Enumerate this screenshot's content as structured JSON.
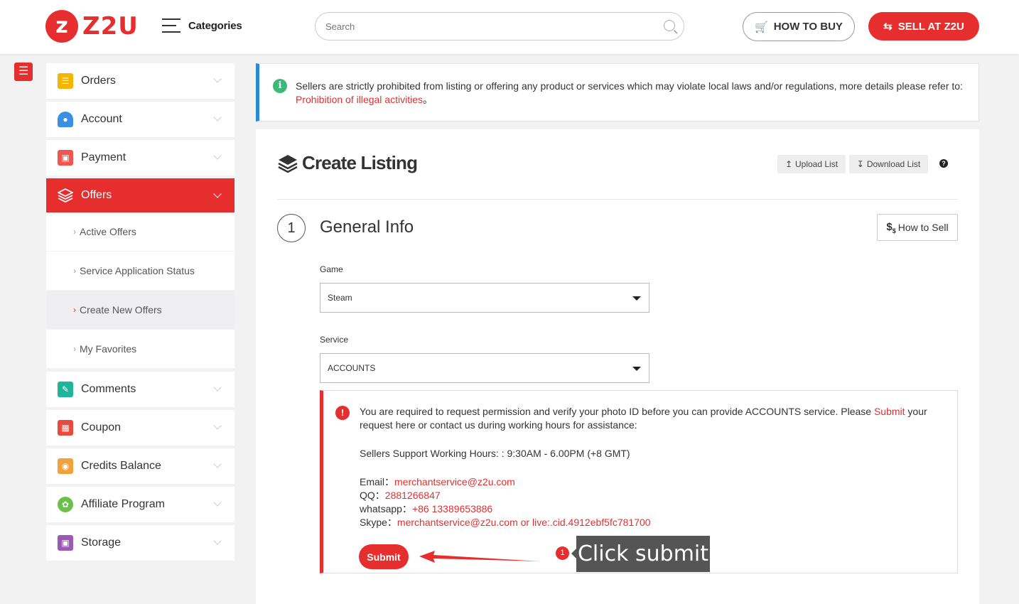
{
  "header": {
    "logo_text": "Z2U",
    "logo_mark": "z",
    "categories_label": "Categories",
    "search_placeholder": "Search",
    "how_to_buy_label": "HOW TO BUY",
    "sell_label": "SELL AT Z2U"
  },
  "sidebar": {
    "items": [
      {
        "label": "Orders",
        "icon": "orders-icon",
        "color": "#f5b400"
      },
      {
        "label": "Account",
        "icon": "account-icon",
        "color": "#3b8fe6"
      },
      {
        "label": "Payment",
        "icon": "payment-icon",
        "color": "#f2554d"
      },
      {
        "label": "Offers",
        "icon": "offers-icon",
        "color": "#ffffff"
      },
      {
        "label": "Comments",
        "icon": "comments-icon",
        "color": "#1fb59a"
      },
      {
        "label": "Coupon",
        "icon": "coupon-icon",
        "color": "#e84b3c"
      },
      {
        "label": "Credits Balance",
        "icon": "credits-icon",
        "color": "#f3a13c"
      },
      {
        "label": "Affiliate Program",
        "icon": "affiliate-icon",
        "color": "#6cc04a"
      },
      {
        "label": "Storage",
        "icon": "storage-icon",
        "color": "#9b59b6"
      }
    ],
    "sub_items": [
      {
        "label": "Active Offers"
      },
      {
        "label": "Service Application Status"
      },
      {
        "label": "Create New Offers"
      },
      {
        "label": "My Favorites"
      }
    ]
  },
  "notice": {
    "text": "Sellers are strictly prohibited from listing or offering any product or services which may violate local laws and/or regulations, more details please refer to: ",
    "link": "Prohibition of illegal activities",
    "end": "。"
  },
  "panel": {
    "title": "Create Listing",
    "upload_label": "Upload List",
    "download_label": "Download List",
    "help": "?",
    "step_number": "1",
    "section_title": "General Info",
    "how_to_sell_label": "How to Sell",
    "how_to_sell_prefix": "$",
    "how_to_sell_sub": "$",
    "game_label": "Game",
    "game_value": "Steam",
    "service_label": "Service",
    "service_value": "ACCOUNTS"
  },
  "alert": {
    "line1_pre": "You are required to request permission and verify your photo ID before you can provide ACCOUNTS service. Please ",
    "line1_link": "Submit",
    "line1_post": " your request here or contact us during working hours for assistance:",
    "hours": "Sellers Support Working Hours: : 9:30AM - 6.00PM (+8 GMT)",
    "email_label": "Email：",
    "email_value": "merchantservice@z2u.com",
    "qq_label": "QQ：",
    "qq_value": "2881266847",
    "whatsapp_label": "whatsapp：",
    "whatsapp_value": "+86 13389653886",
    "skype_label": "Skype：",
    "skype_value": "merchantservice@z2u.com or live:.cid.4912ebf5fc781700",
    "submit_label": "Submit"
  },
  "tutorial": {
    "badge": "1",
    "tooltip": "Click submit"
  }
}
